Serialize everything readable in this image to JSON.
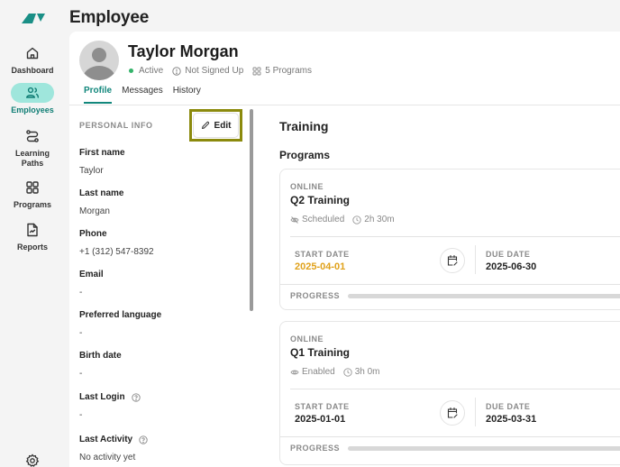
{
  "app": {
    "brand_color": "#1a8f86",
    "page_title": "Employee"
  },
  "sidebar": {
    "items": [
      {
        "label": "Dashboard",
        "icon": "home-icon",
        "active": false
      },
      {
        "label": "Employees",
        "icon": "users-icon",
        "active": true
      },
      {
        "label": "Learning Paths",
        "icon": "route-icon",
        "active": false
      },
      {
        "label": "Programs",
        "icon": "grid-icon",
        "active": false
      },
      {
        "label": "Reports",
        "icon": "report-icon",
        "active": false
      }
    ],
    "settings_icon": "gear-icon"
  },
  "employee": {
    "name": "Taylor Morgan",
    "status": "Active",
    "status_color": "#34b36a",
    "signup_status": "Not Signed Up",
    "programs_count": "5 Programs"
  },
  "tabs": [
    {
      "label": "Profile",
      "active": true
    },
    {
      "label": "Messages",
      "active": false
    },
    {
      "label": "History",
      "active": false
    }
  ],
  "personal_info": {
    "section_label": "PERSONAL INFO",
    "edit_label": "Edit",
    "fields": [
      {
        "label": "First name",
        "value": "Taylor"
      },
      {
        "label": "Last name",
        "value": "Morgan"
      },
      {
        "label": "Phone",
        "value": "+1 (312) 547-8392"
      },
      {
        "label": "Email",
        "value": "-"
      },
      {
        "label": "Preferred language",
        "value": "-"
      },
      {
        "label": "Birth date",
        "value": "-"
      },
      {
        "label": "Last Login",
        "value": "-",
        "help": true
      },
      {
        "label": "Last Activity",
        "value": "No activity yet",
        "help": true
      }
    ]
  },
  "training": {
    "title": "Training",
    "programs_title": "Programs",
    "programs": [
      {
        "mode": "ONLINE",
        "name": "Q2 Training",
        "visibility": "Scheduled",
        "visibility_icon": "eye-off-icon",
        "duration": "2h 30m",
        "start_label": "START DATE",
        "start_date": "2025-04-01",
        "start_highlight": true,
        "due_label": "DUE DATE",
        "due_date": "2025-06-30",
        "progress_label": "PROGRESS",
        "progress": 0
      },
      {
        "mode": "ONLINE",
        "name": "Q1 Training",
        "visibility": "Enabled",
        "visibility_icon": "eye-icon",
        "duration": "3h 0m",
        "start_label": "START DATE",
        "start_date": "2025-01-01",
        "start_highlight": false,
        "due_label": "DUE DATE",
        "due_date": "2025-03-31",
        "progress_label": "PROGRESS",
        "progress": 0
      }
    ]
  }
}
